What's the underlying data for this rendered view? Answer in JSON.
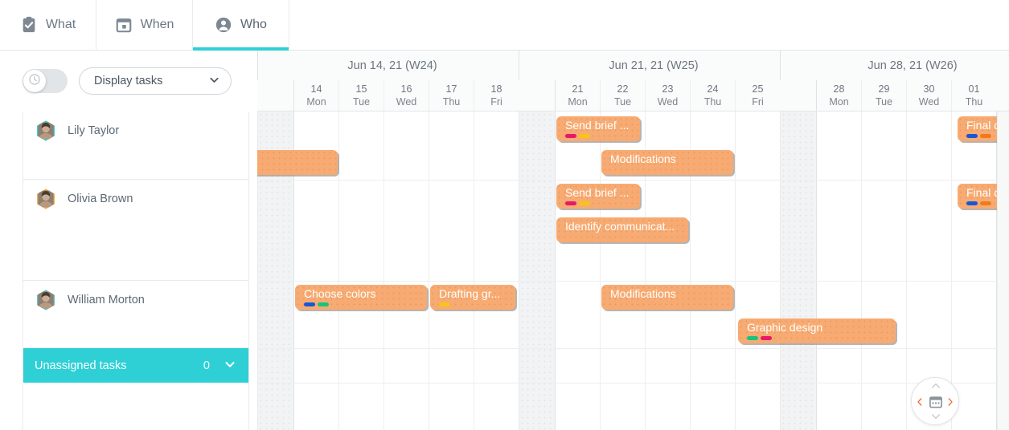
{
  "tabs": [
    {
      "label": "What",
      "icon": "clipboard-check-icon",
      "active": false
    },
    {
      "label": "When",
      "icon": "calendar-icon",
      "active": false
    },
    {
      "label": "Who",
      "icon": "person-icon",
      "active": true
    }
  ],
  "toolbar": {
    "toggle": {
      "name": "time-tracking-toggle",
      "state": "off",
      "icon": "clock-icon"
    },
    "select": {
      "value": "Display tasks",
      "icon": "chevron-down-icon"
    }
  },
  "timeline": {
    "weeks": [
      {
        "label": "Jun 14, 21 (W24)"
      },
      {
        "label": "Jun 21, 21 (W25)"
      },
      {
        "label": "Jun 28, 21 (W26)"
      }
    ],
    "days": [
      {
        "num": "14",
        "dow": "Mon",
        "weekend": false
      },
      {
        "num": "15",
        "dow": "Tue",
        "weekend": false
      },
      {
        "num": "16",
        "dow": "Wed",
        "weekend": false
      },
      {
        "num": "17",
        "dow": "Thu",
        "weekend": false
      },
      {
        "num": "18",
        "dow": "Fri",
        "weekend": false
      },
      {
        "num": "21",
        "dow": "Mon",
        "weekend": false
      },
      {
        "num": "22",
        "dow": "Tue",
        "weekend": false
      },
      {
        "num": "23",
        "dow": "Wed",
        "weekend": false
      },
      {
        "num": "24",
        "dow": "Thu",
        "weekend": false
      },
      {
        "num": "25",
        "dow": "Fri",
        "weekend": false
      },
      {
        "num": "28",
        "dow": "Mon",
        "weekend": false
      },
      {
        "num": "29",
        "dow": "Tue",
        "weekend": false
      },
      {
        "num": "30",
        "dow": "Wed",
        "weekend": false
      },
      {
        "num": "01",
        "dow": "Thu",
        "weekend": false
      }
    ]
  },
  "rows": [
    {
      "name": "Lily Taylor",
      "avatar_border": "#2ec9cf"
    },
    {
      "name": "Olivia Brown",
      "avatar_border": "#f0ad3c"
    },
    {
      "name": "William Morton",
      "avatar_border": "#5eb8bf"
    }
  ],
  "unassigned": {
    "label": "Unassigned tasks",
    "count": "0",
    "icon": "chevron-down-icon",
    "color": "#2ed0d6"
  },
  "tasks": [
    {
      "label": "",
      "row": 0,
      "chips": []
    },
    {
      "label": "Send brief ...",
      "row": 0,
      "chips": [
        "#e8186a",
        "#f5c518"
      ]
    },
    {
      "label": "Modifications",
      "row": 0,
      "chips": []
    },
    {
      "label": "Final de",
      "row": 0,
      "chips": [
        "#1757d6",
        "#f07a1e"
      ]
    },
    {
      "label": "Send brief ...",
      "row": 1,
      "chips": [
        "#e8186a",
        "#f5c518"
      ]
    },
    {
      "label": "Identify communicat...",
      "row": 1,
      "chips": []
    },
    {
      "label": "Final de",
      "row": 1,
      "chips": [
        "#1757d6",
        "#f07a1e"
      ]
    },
    {
      "label": "Choose colors",
      "row": 2,
      "chips": [
        "#1757d6",
        "#16c47f"
      ]
    },
    {
      "label": "Drafting gr...",
      "row": 2,
      "chips": [
        "#f5c518"
      ]
    },
    {
      "label": "Modifications",
      "row": 2,
      "chips": []
    },
    {
      "label": "Graphic design",
      "row": 2,
      "chips": [
        "#16c47f",
        "#e8186a"
      ]
    }
  ],
  "nav": {
    "prev": "chevron-left-icon",
    "next": "chevron-right-icon",
    "up": "chevron-up-icon",
    "down": "chevron-down-icon",
    "center": "calendar-icon",
    "accent": "#f4622c"
  },
  "colors": {
    "accent_teal": "#2ed0d6",
    "bar_orange": "#f7ab72",
    "text": "#5c6873"
  }
}
